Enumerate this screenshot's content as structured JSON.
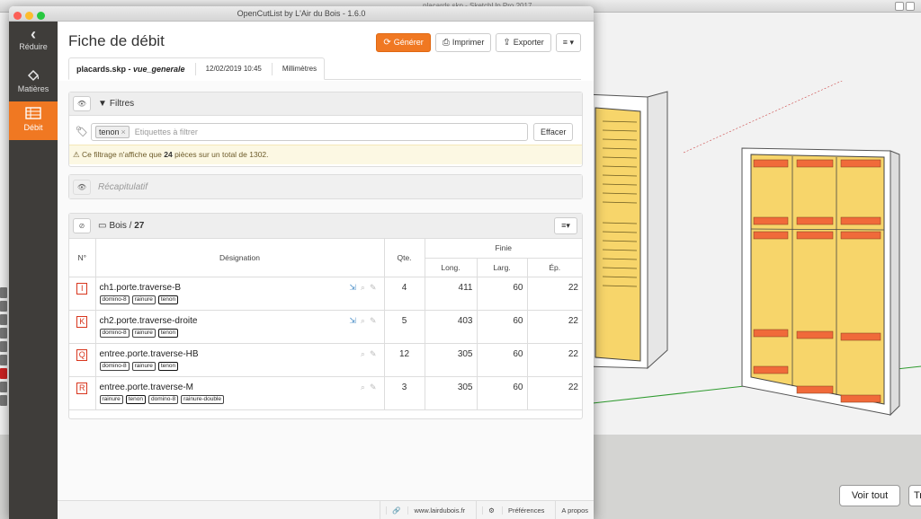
{
  "background": {
    "title": "placards.skp - SketchUp Pro 2017",
    "voir_tout": "Voir tout",
    "tra": "Tra"
  },
  "window": {
    "title": "OpenCutList by L'Air du Bois - 1.6.0"
  },
  "sidebar": {
    "items": [
      {
        "label": "Réduire",
        "icon": "chevron-left-icon"
      },
      {
        "label": "Matières",
        "icon": "paint-bucket-icon"
      },
      {
        "label": "Débit",
        "icon": "list-icon"
      }
    ]
  },
  "header": {
    "title": "Fiche de débit",
    "generate_label": "Générer",
    "print_label": "Imprimer",
    "export_label": "Exporter",
    "menu_label": "≡ ▾"
  },
  "tab": {
    "file": "placards.skp",
    "separator": " - ",
    "scene": "vue_generale",
    "date": "12/02/2019 10:45",
    "unit": "Millimètres"
  },
  "filters": {
    "title": "Filtres",
    "tag": "tenon",
    "placeholder": "Etiquettes à filtrer",
    "clear_label": "Effacer",
    "alert_pre": "Ce filtrage n'affiche que ",
    "alert_count": "24",
    "alert_post": " pièces sur un total de 1302."
  },
  "recap": {
    "label": "Récapitulatif"
  },
  "bois": {
    "title": "Bois / ",
    "count": "27",
    "columns": {
      "no": "N°",
      "designation": "Désignation",
      "qte": "Qte.",
      "finie": "Finie",
      "long": "Long.",
      "larg": "Larg.",
      "ep": "Ép."
    },
    "rows": [
      {
        "letter": "I",
        "name": "ch1.porte.traverse-B",
        "tags": [
          "domino-8",
          "rainure",
          "tenon"
        ],
        "qte": "4",
        "long": "411",
        "larg": "60",
        "ep": "22"
      },
      {
        "letter": "K",
        "name": "ch2.porte.traverse-droite",
        "tags": [
          "domino-8",
          "rainure",
          "tenon"
        ],
        "qte": "5",
        "long": "403",
        "larg": "60",
        "ep": "22"
      },
      {
        "letter": "Q",
        "name": "entree.porte.traverse-HB",
        "tags": [
          "domino-8",
          "rainure",
          "tenon"
        ],
        "qte": "12",
        "long": "305",
        "larg": "60",
        "ep": "22"
      },
      {
        "letter": "R",
        "name": "entree.porte.traverse-M",
        "tags": [
          "rainure",
          "tenon",
          "domino-8",
          "rainure-double"
        ],
        "qte": "3",
        "long": "305",
        "larg": "60",
        "ep": "22"
      }
    ]
  },
  "footer": {
    "site": "www.lairdubois.fr",
    "prefs": "Préférences",
    "about": "A propos"
  },
  "colors": {
    "accent": "#f07822",
    "sidebar": "#3f3d3a",
    "letter": "#d8361e"
  }
}
